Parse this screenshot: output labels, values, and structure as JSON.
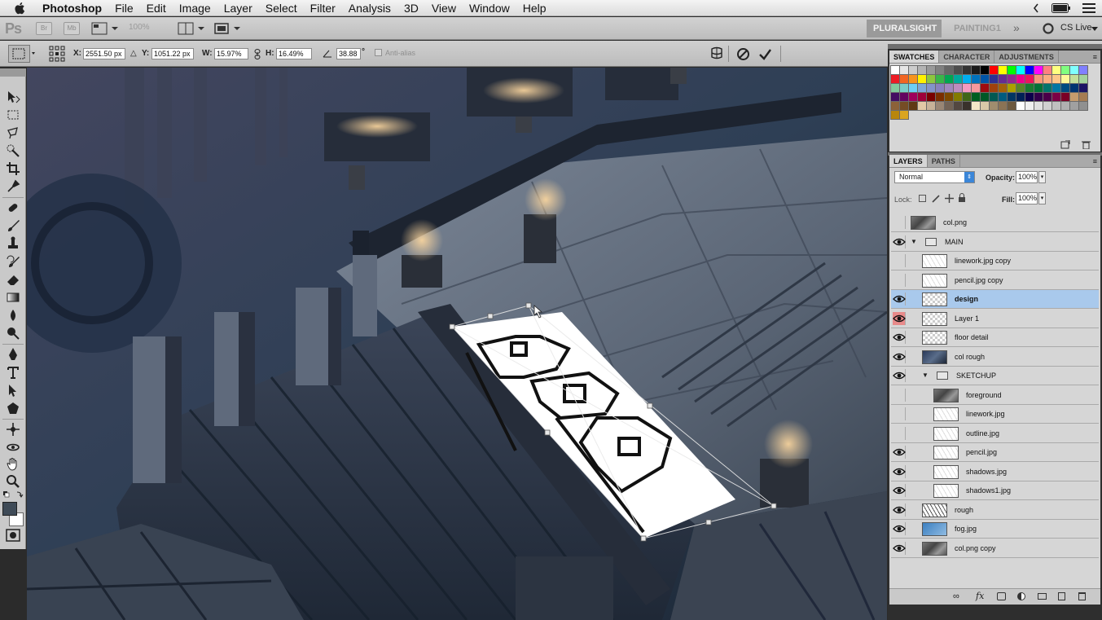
{
  "menubar": {
    "app_name": "Photoshop",
    "items": [
      "File",
      "Edit",
      "Image",
      "Layer",
      "Select",
      "Filter",
      "Analysis",
      "3D",
      "View",
      "Window",
      "Help"
    ]
  },
  "appbar": {
    "logo": "Ps",
    "mini_br": "Br",
    "mini_mb": "Mb",
    "zoom": "100%",
    "workspace_active": "PLURALSIGHT",
    "workspace_other": "PAINTING1",
    "more": "»",
    "cs_live": "CS Live"
  },
  "options": {
    "x_label": "X:",
    "x_value": "2551.50 px",
    "y_label": "Y:",
    "y_value": "1051.22 px",
    "w_label": "W:",
    "w_value": "15.97%",
    "h_label": "H:",
    "h_value": "16.49%",
    "angle_value": "38.88",
    "degree": "°",
    "antialias": "Anti-alias"
  },
  "swatches_panel": {
    "tabs": [
      "SWATCHES",
      "CHARACTER",
      "ADJUSTMENTS"
    ],
    "colors": [
      "#ffffff",
      "#e6e6e6",
      "#cccccc",
      "#b3b3b3",
      "#999999",
      "#808080",
      "#666666",
      "#4d4d4d",
      "#333333",
      "#1a1a1a",
      "#000000",
      "#ff0000",
      "#ffff00",
      "#00ff00",
      "#00ffff",
      "#0000ff",
      "#ff00ff",
      "#ff8080",
      "#ffff80",
      "#80ff80",
      "#80ffff",
      "#8080ff",
      "#ed1c24",
      "#f26522",
      "#f7941d",
      "#fff200",
      "#8dc63f",
      "#39b54a",
      "#00a651",
      "#00a99d",
      "#00aeef",
      "#0072bc",
      "#0054a6",
      "#2e3192",
      "#662d91",
      "#92278f",
      "#ec008c",
      "#ed145b",
      "#f69679",
      "#f9ad81",
      "#fdc689",
      "#fff799",
      "#c4df9b",
      "#a3d39c",
      "#82ca9c",
      "#7accc8",
      "#6dcff6",
      "#7da7d9",
      "#8393ca",
      "#8781bd",
      "#a187be",
      "#bd8cbf",
      "#f49ac1",
      "#f6989d",
      "#9e0b0f",
      "#a0410d",
      "#a36209",
      "#aba000",
      "#598527",
      "#1a7b30",
      "#007236",
      "#00746b",
      "#0076a3",
      "#004b80",
      "#003471",
      "#1b1464",
      "#440e62",
      "#630460",
      "#9e005d",
      "#9e0039",
      "#790000",
      "#7b2e00",
      "#7d4900",
      "#827b00",
      "#406618",
      "#005e20",
      "#005826",
      "#005952",
      "#005b7f",
      "#003663",
      "#002157",
      "#0d004c",
      "#32004b",
      "#4b0049",
      "#7b0046",
      "#7a0026",
      "#c69c6d",
      "#a67c52",
      "#8c6239",
      "#754c24",
      "#603913",
      "#e2c9a6",
      "#c7b299",
      "#998675",
      "#736357",
      "#534741",
      "#39312b",
      "#f5e6c8",
      "#d9c8a8",
      "#a08d6e",
      "#8b7355",
      "#6d5a40",
      "#ffffff",
      "#f0f0f0",
      "#e0e0e0",
      "#d0d0d0",
      "#c0c0c0",
      "#b0b0b0",
      "#a0a0a0",
      "#909090",
      "#b8860b",
      "#daa520"
    ]
  },
  "layers_panel": {
    "tabs": [
      "LAYERS",
      "PATHS"
    ],
    "blend_mode": "Normal",
    "opacity_label": "Opacity:",
    "opacity_value": "100%",
    "lock_label": "Lock:",
    "fill_label": "Fill:",
    "fill_value": "100%",
    "layers": [
      {
        "name": "col.png",
        "visible": false,
        "kind": "photo",
        "indent": 0
      },
      {
        "name": "MAIN",
        "visible": true,
        "kind": "group",
        "indent": 0
      },
      {
        "name": "linework.jpg copy",
        "visible": false,
        "kind": "sketch",
        "indent": 1
      },
      {
        "name": "pencil.jpg copy",
        "visible": false,
        "kind": "sketch",
        "indent": 1
      },
      {
        "name": "design",
        "visible": true,
        "kind": "checker",
        "indent": 1,
        "selected": true
      },
      {
        "name": "Layer 1",
        "visible": true,
        "kind": "checker",
        "indent": 1,
        "red": true
      },
      {
        "name": "floor detail",
        "visible": true,
        "kind": "checker",
        "indent": 1
      },
      {
        "name": "col rough",
        "visible": true,
        "kind": "photo-blue",
        "indent": 1
      },
      {
        "name": "SKETCHUP",
        "visible": true,
        "kind": "group",
        "indent": 1
      },
      {
        "name": "foreground",
        "visible": false,
        "kind": "photo",
        "indent": 2
      },
      {
        "name": "linework.jpg",
        "visible": false,
        "kind": "sketch",
        "indent": 2
      },
      {
        "name": "outline.jpg",
        "visible": false,
        "kind": "sketch",
        "indent": 2
      },
      {
        "name": "pencil.jpg",
        "visible": true,
        "kind": "sketch",
        "indent": 2
      },
      {
        "name": "shadows.jpg",
        "visible": true,
        "kind": "sketch",
        "indent": 2
      },
      {
        "name": "shadows1.jpg",
        "visible": true,
        "kind": "sketch",
        "indent": 2
      },
      {
        "name": "rough",
        "visible": true,
        "kind": "sketch-dark",
        "indent": 1
      },
      {
        "name": "fog.jpg",
        "visible": true,
        "kind": "fog",
        "indent": 1
      },
      {
        "name": "col.png copy",
        "visible": true,
        "kind": "photo",
        "indent": 1
      }
    ]
  }
}
